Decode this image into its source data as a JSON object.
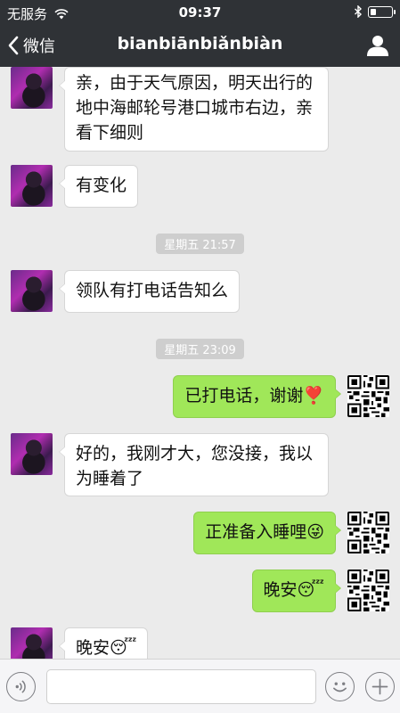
{
  "status_bar": {
    "carrier": "无服务",
    "time": "09:37"
  },
  "nav": {
    "back_label": "微信",
    "title": "bianbiānbiǎnbiàn"
  },
  "icons": {
    "back": "chevron-left-icon",
    "profile": "person-icon",
    "wifi": "wifi-icon",
    "bluetooth": "bluetooth-icon",
    "battery": "battery-icon",
    "voice": "voice-icon",
    "emoji": "emoji-icon",
    "plus": "plus-icon"
  },
  "colors": {
    "navbar": "#2f3236",
    "chat_bg": "#ebebeb",
    "my_bubble": "#a0e759",
    "their_bubble": "#ffffff",
    "timestamp_bg": "#cecece"
  },
  "messages": [
    {
      "sender": "them",
      "text": "亲，由于天气原因，明天出行的地中海邮轮号港口城市右边，亲看下细则"
    },
    {
      "sender": "them",
      "text": "有变化"
    },
    {
      "type": "time",
      "text": "星期五 21:57"
    },
    {
      "sender": "them",
      "text": "领队有打电话告知么"
    },
    {
      "type": "time",
      "text": "星期五 23:09"
    },
    {
      "sender": "me",
      "text": "已打电话，谢谢❣️"
    },
    {
      "sender": "them",
      "text": "好的，我刚才大，您没接，我以为睡着了"
    },
    {
      "sender": "me",
      "text": "正准备入睡哩😜"
    },
    {
      "sender": "me",
      "text": "晚安😴"
    },
    {
      "sender": "them",
      "text": "晚安😴"
    }
  ],
  "input": {
    "value": "",
    "placeholder": ""
  }
}
